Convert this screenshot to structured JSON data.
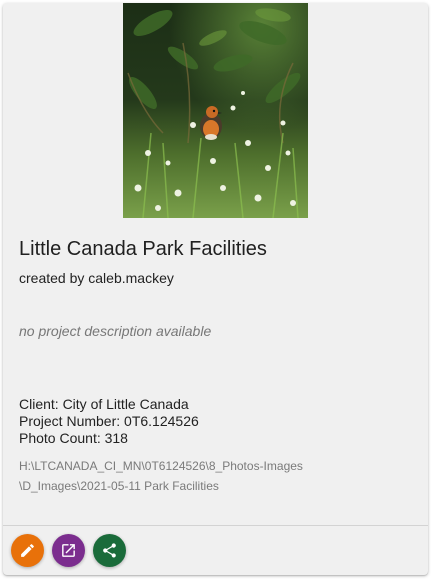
{
  "project": {
    "title": "Little Canada Park Facilities",
    "created_by": "created by caleb.mackey",
    "description": "no project description available",
    "client": "Client: City of Little Canada",
    "project_number": "Project Number: 0T6.124526",
    "photo_count": "Photo Count: 318",
    "path": "H:\\LTCANADA_CI_MN\\0T6124526\\8_Photos-Images\\D_Images\\2021-05-11 Park Facilities"
  },
  "actions": {
    "edit": {
      "icon": "pencil-icon",
      "color": "#e8710a"
    },
    "open": {
      "icon": "open-in-new-icon",
      "color": "#7b2d8e"
    },
    "share": {
      "icon": "share-icon",
      "color": "#1a6b3a"
    }
  },
  "thumbnail": {
    "subject": "robin-bird-photo"
  }
}
